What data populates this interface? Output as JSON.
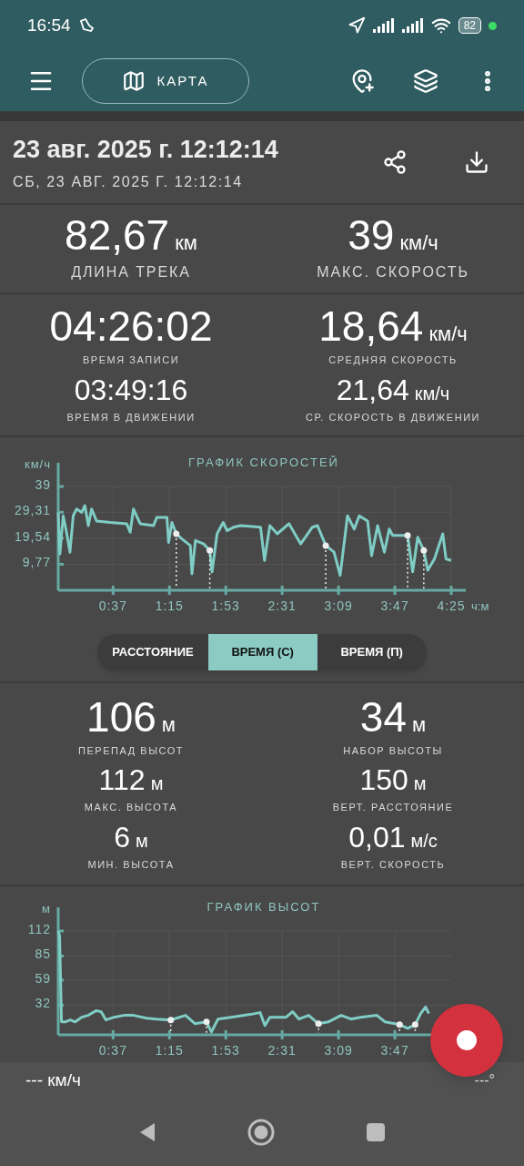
{
  "status_bar": {
    "time": "16:54",
    "battery": "82"
  },
  "toolbar": {
    "map_button": "КАРТА"
  },
  "track": {
    "title": "23 авг. 2025 г. 12:12:14",
    "subtitle": "СБ, 23 АВГ. 2025 Г. 12:12:14"
  },
  "stats": [
    {
      "value": "82,67",
      "unit": "км",
      "label": "ДЛИНА ТРЕКА",
      "kind": "headline"
    },
    {
      "value": "39",
      "unit": "км/ч",
      "label": "МАКС. СКОРОСТЬ",
      "kind": "headline"
    },
    {
      "value": "04:26:02",
      "label": "ВРЕМЯ ЗАПИСИ",
      "kind": "primary"
    },
    {
      "value": "18,64",
      "unit": "км/ч",
      "label": "СРЕДНЯЯ СКОРОСТЬ",
      "kind": "primary"
    },
    {
      "value": "03:49:16",
      "label": "ВРЕМЯ В ДВИЖЕНИИ",
      "kind": "secondary"
    },
    {
      "value": "21,64",
      "unit": "км/ч",
      "label": "СР. СКОРОСТЬ В ДВИЖЕНИИ",
      "kind": "secondary"
    }
  ],
  "speed_chart": {
    "chart_data": {
      "type": "line",
      "title": "ГРАФИК СКОРОСТЕЙ",
      "xlabel": "ч:м",
      "ylabel": "км/ч",
      "x": [
        0,
        1.1,
        3.4,
        5.6,
        7.9,
        10.1,
        12.4,
        15.8,
        18,
        20.3,
        22.5,
        25.9,
        35,
        46.2,
        48.5,
        50.7,
        55.3,
        64.3,
        66.5,
        73.3,
        74.4,
        76.7,
        79.6,
        83.4,
        89.1,
        90.2,
        92.5,
        98.1,
        102.2,
        103.7,
        107.1,
        111.2,
        113.9,
        118.4,
        122.9,
        136.4,
        139.1,
        142.7,
        147.7,
        155.6,
        163.5,
        171.4,
        174.8,
        180.4,
        186,
        190.1,
        195.1,
        199.6,
        203,
        208.6,
        211.3,
        215.4,
        219.9,
        223.2,
        225.5,
        235.6,
        239,
        242.4,
        246.5,
        249.2,
        253.7,
        259.3,
        261.5,
        265
      ],
      "grid": true,
      "series": [
        {
          "color": "#7fcdc5",
          "values": [
            29.3,
            13.7,
            28,
            21.8,
            14.3,
            28,
            30.5,
            29.3,
            31.8,
            24.3,
            30.5,
            26,
            25.5,
            25,
            21.8,
            30.5,
            25,
            24.3,
            27.4,
            27.4,
            18,
            25.5,
            21.2,
            19.3,
            16.8,
            6.2,
            18.7,
            17.4,
            15,
            6.9,
            21.2,
            25.5,
            22.4,
            23.7,
            24.3,
            23.7,
            11.2,
            24.3,
            21.2,
            25,
            17.4,
            23.7,
            24.3,
            16.8,
            14.3,
            5.6,
            28,
            23,
            28,
            26,
            13,
            24.3,
            14.3,
            23,
            20.6,
            20.6,
            6.9,
            19.9,
            15,
            7.5,
            11.8,
            21.2,
            11.8,
            11.2
          ]
        },
        {
          "color": "#eeeeee",
          "line_style": "dotted",
          "marker": "circle",
          "values": [
            null,
            null,
            null,
            null,
            null,
            null,
            null,
            null,
            null,
            null,
            null,
            null,
            null,
            null,
            null,
            null,
            null,
            null,
            null,
            null,
            null,
            null,
            21.2,
            null,
            null,
            null,
            null,
            null,
            15,
            null,
            null,
            null,
            null,
            null,
            null,
            null,
            null,
            null,
            null,
            null,
            null,
            null,
            null,
            16.8,
            null,
            null,
            null,
            null,
            null,
            null,
            null,
            null,
            null,
            null,
            null,
            20.6,
            null,
            null,
            15,
            null,
            null,
            null,
            null,
            null
          ]
        }
      ],
      "xlim": [
        0,
        265
      ],
      "ylim": [
        0,
        39
      ],
      "xticks": [
        {
          "value": 37,
          "label": "0:37"
        },
        {
          "value": 75,
          "label": "1:15"
        },
        {
          "value": 113,
          "label": "1:53"
        },
        {
          "value": 151,
          "label": "2:31"
        },
        {
          "value": 189,
          "label": "3:09"
        },
        {
          "value": 227,
          "label": "3:47"
        },
        {
          "value": 265,
          "label": "4:25"
        }
      ],
      "yticks": [
        {
          "value": 9.77,
          "label": "9,77"
        },
        {
          "value": 19.54,
          "label": "19,54"
        },
        {
          "value": 29.31,
          "label": "29,31"
        },
        {
          "value": 39,
          "label": "39"
        }
      ]
    }
  },
  "axis_modes": [
    {
      "label": "РАССТОЯНИЕ",
      "selected": false
    },
    {
      "label": "ВРЕМЯ (С)",
      "selected": true
    },
    {
      "label": "ВРЕМЯ (П)",
      "selected": false
    }
  ],
  "elevation_stats": [
    {
      "value": "106",
      "unit": "м",
      "label": "ПЕРЕПАД ВЫСОТ",
      "kind": "primary"
    },
    {
      "value": "34",
      "unit": "м",
      "label": "НАБОР ВЫСОТЫ",
      "kind": "primary"
    },
    {
      "value": "112",
      "unit": "м",
      "label": "МАКС. ВЫСОТА",
      "kind": "secondary"
    },
    {
      "value": "150",
      "unit": "м",
      "label": "ВЕРТ. РАССТОЯНИЕ",
      "kind": "secondary"
    },
    {
      "value": "6",
      "unit": "м",
      "label": "МИН. ВЫСОТА",
      "kind": "secondary"
    },
    {
      "value": "0,01",
      "unit": "м/с",
      "label": "ВЕРТ. СКОРОСТЬ",
      "kind": "secondary"
    }
  ],
  "elevation_chart": {
    "chart_data": {
      "type": "line",
      "title": "ГРАФИК ВЫСОТ",
      "ylabel": "м",
      "x": [
        0,
        0.9,
        2.2,
        4.8,
        8.1,
        11.4,
        15.8,
        20.1,
        25.6,
        28.9,
        32.2,
        37.6,
        44.2,
        50.8,
        59.5,
        66.1,
        75.9,
        85.8,
        92.3,
        100,
        103.3,
        107.7,
        116.4,
        129.5,
        136.1,
        139.4,
        142.7,
        153.6,
        158,
        162.4,
        168.9,
        175.5,
        182.1,
        190.8,
        197.4,
        203.9,
        214.9,
        220.4,
        230.2,
        235.7,
        240.7,
        244.4,
        247.7,
        249.9
      ],
      "grid": true,
      "series": [
        {
          "color": "#7fcdc5",
          "values": [
            112,
            107,
            14,
            14,
            16,
            14,
            19,
            21,
            26,
            25,
            16,
            19,
            21,
            21,
            18,
            17,
            16,
            21,
            12,
            14,
            3,
            17,
            19,
            22,
            24,
            10,
            19,
            19,
            25,
            17,
            21,
            12,
            14,
            21,
            17,
            19,
            21,
            14,
            11,
            7,
            11,
            23,
            30,
            23
          ]
        },
        {
          "color": "#eeeeee",
          "line_style": "dotted",
          "marker": "circle",
          "values": [
            null,
            null,
            null,
            null,
            null,
            null,
            null,
            null,
            null,
            null,
            null,
            null,
            null,
            null,
            null,
            null,
            16,
            null,
            null,
            14,
            null,
            null,
            null,
            null,
            null,
            null,
            null,
            null,
            null,
            null,
            null,
            12,
            null,
            null,
            null,
            null,
            null,
            null,
            11,
            null,
            11,
            null,
            null,
            null
          ]
        }
      ],
      "xlim": [
        0,
        265
      ],
      "ylim": [
        0,
        112
      ],
      "xticks": [
        {
          "value": 37,
          "label": "0:37"
        },
        {
          "value": 75,
          "label": "1:15"
        },
        {
          "value": 113,
          "label": "1:53"
        },
        {
          "value": 151,
          "label": "2:31"
        },
        {
          "value": 189,
          "label": "3:09"
        },
        {
          "value": 227,
          "label": "3:47"
        }
      ],
      "yticks": [
        {
          "value": 32,
          "label": "32"
        },
        {
          "value": 59,
          "label": "59"
        },
        {
          "value": 85,
          "label": "85"
        },
        {
          "value": 112,
          "label": "112"
        }
      ]
    }
  },
  "footer": {
    "speed": "--- км/ч",
    "heading": "---°"
  }
}
